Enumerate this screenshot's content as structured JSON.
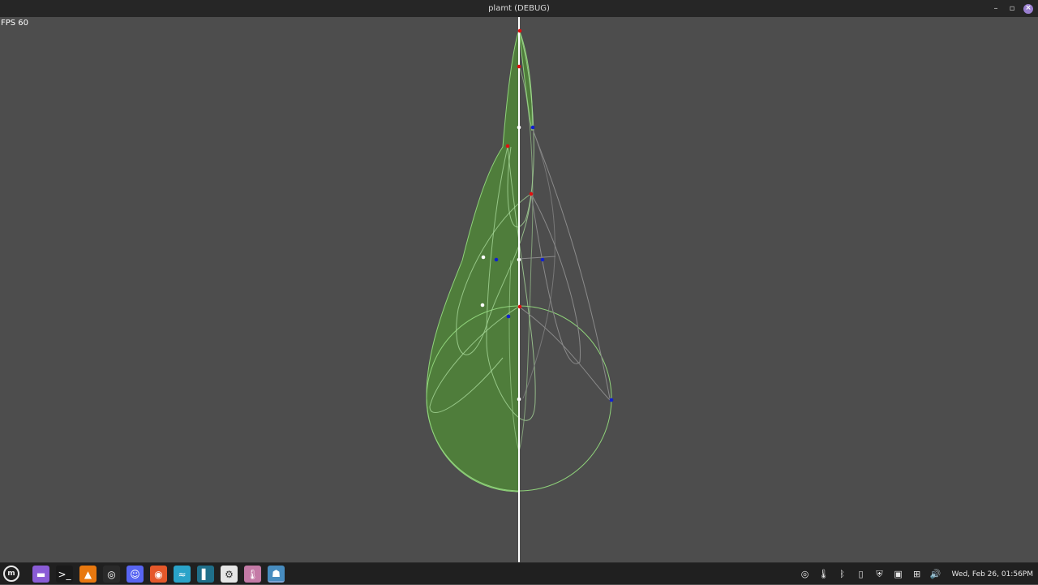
{
  "window": {
    "title": "plamt (DEBUG)",
    "minimize_glyph": "–",
    "maximize_glyph": "▫",
    "close_glyph": "×"
  },
  "viewport": {
    "fps_label": "FPS 60",
    "colors": {
      "background": "#4d4d4d",
      "leaf_fill": "#4f7d3b",
      "leaf_outline": "#8fd27a",
      "stem": "#ffffff",
      "guide": "#8a8a8a",
      "point_red": "#e01010",
      "point_blue": "#1020d0",
      "point_white": "#ffffff"
    }
  },
  "taskbar": {
    "menu_glyph": "m",
    "launchers": [
      {
        "name": "files-icon",
        "glyph": "▬",
        "bg": "#8a5cd6"
      },
      {
        "name": "terminal-icon",
        "glyph": ">_",
        "bg": "#1a1a1a"
      },
      {
        "name": "vlc-icon",
        "glyph": "▲",
        "bg": "#e8780f"
      },
      {
        "name": "obs-icon",
        "glyph": "◎",
        "bg": "#2a2a2a"
      },
      {
        "name": "discord-icon",
        "glyph": "☺",
        "bg": "#5865f2"
      },
      {
        "name": "firefox-icon",
        "glyph": "◉",
        "bg": "#e5582a"
      },
      {
        "name": "cloud-app-icon",
        "glyph": "≈",
        "bg": "#2aa3c9"
      },
      {
        "name": "panel-app-icon",
        "glyph": "▌",
        "bg": "#1f6f8a"
      },
      {
        "name": "settings-icon",
        "glyph": "⚙",
        "bg": "#e6e6e6"
      },
      {
        "name": "temperature-app-icon",
        "glyph": "🌡",
        "bg": "#c47aa6"
      },
      {
        "name": "godot-icon",
        "glyph": "☗",
        "bg": "#478cbf",
        "active": true
      }
    ],
    "tray": [
      {
        "name": "obs-tray-icon",
        "glyph": "◎"
      },
      {
        "name": "thermometer-tray-icon",
        "glyph": "🌡"
      },
      {
        "name": "bluetooth-icon",
        "glyph": "ᛒ"
      },
      {
        "name": "clipboard-icon",
        "glyph": "▯"
      },
      {
        "name": "update-shield-icon",
        "glyph": "⛨"
      },
      {
        "name": "notes-icon",
        "glyph": "▣"
      },
      {
        "name": "network-icon",
        "glyph": "⊞"
      },
      {
        "name": "volume-icon",
        "glyph": "🔊"
      }
    ],
    "clock": "Wed, Feb 26, 01:56PM"
  }
}
